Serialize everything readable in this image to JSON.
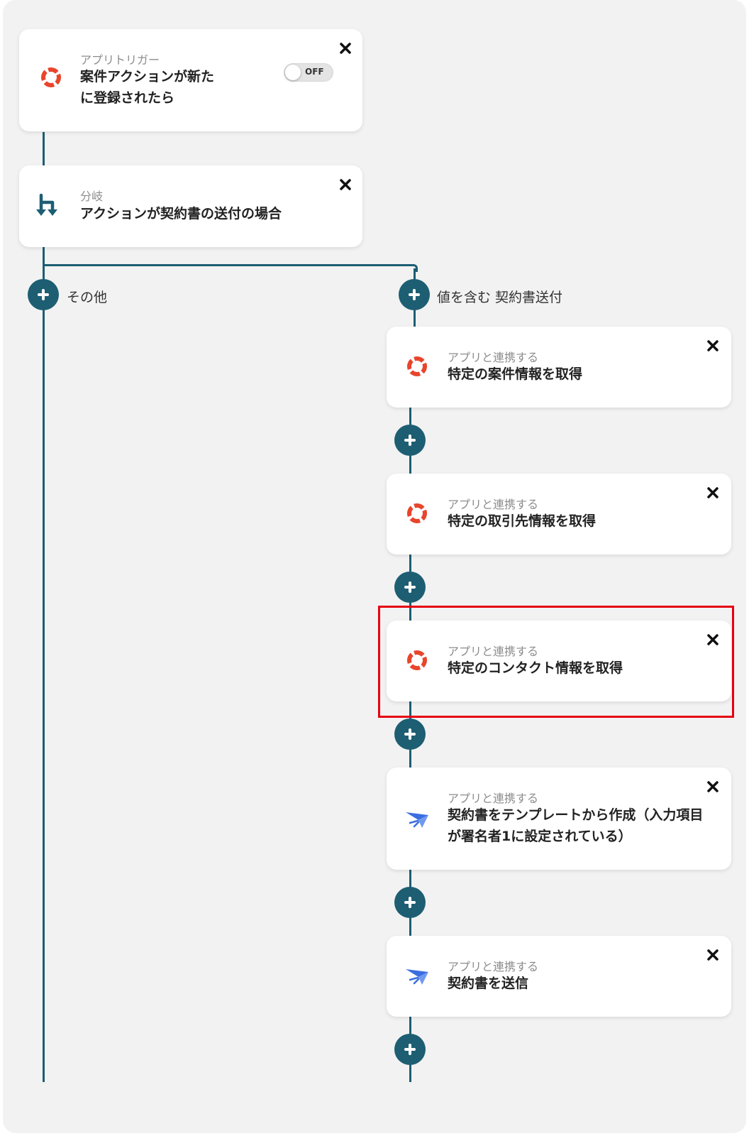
{
  "colors": {
    "connector": "#1d5e73",
    "highlight": "#e60012",
    "app_red": "#e8452c",
    "app_blue": "#3b6fe0"
  },
  "trigger": {
    "sub": "アプリトリガー",
    "title_line1": "案件アクションが新た",
    "title_line2": "に登録されたら",
    "toggle_label": "OFF",
    "icon": "lifebuoy-icon"
  },
  "branch": {
    "sub": "分岐",
    "title": "アクションが契約書の送付の場合",
    "icon": "branch-icon",
    "left_label": "その他",
    "right_label": "値を含む 契約書送付"
  },
  "steps": [
    {
      "sub": "アプリと連携する",
      "title": "特定の案件情報を取得",
      "icon": "lifebuoy-icon"
    },
    {
      "sub": "アプリと連携する",
      "title": "特定の取引先情報を取得",
      "icon": "lifebuoy-icon"
    },
    {
      "sub": "アプリと連携する",
      "title": "特定のコンタクト情報を取得",
      "icon": "lifebuoy-icon",
      "highlighted": true
    },
    {
      "sub": "アプリと連携する",
      "title_line1": "契約書をテンプレートから作成（入力項目",
      "title_line2": "が署名者1に設定されている）",
      "icon": "paper-plane-icon"
    },
    {
      "sub": "アプリと連携する",
      "title": "契約書を送信",
      "icon": "paper-plane-icon"
    }
  ]
}
